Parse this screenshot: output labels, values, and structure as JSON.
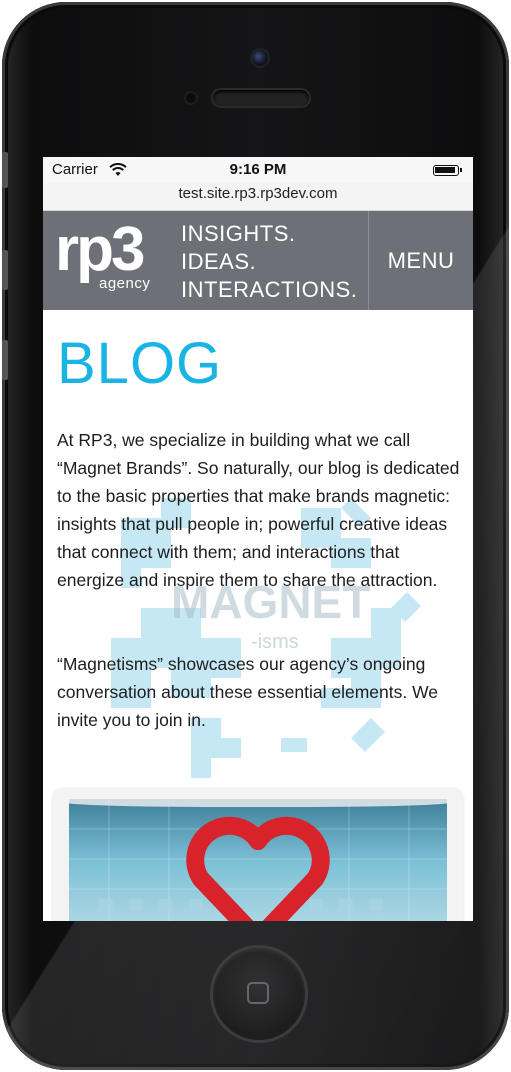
{
  "status_bar": {
    "carrier": "Carrier",
    "time": "9:16 PM"
  },
  "browser": {
    "url": "test.site.rp3.rp3dev.com"
  },
  "header": {
    "logo_text": "rp3",
    "logo_sub": "agency",
    "tagline": [
      "INSIGHTS.",
      "IDEAS.",
      "INTERACTIONS."
    ],
    "menu_label": "MENU"
  },
  "page": {
    "title": "BLOG",
    "paragraphs": [
      "At RP3, we specialize in building what we call “Magnet Brands”. So naturally, our blog is dedicated to the basic properties that make brands magnetic: insights that pull people in; powerful creative ideas that connect with them; and interactions that energize and inspire them to share the attraction.",
      "“Magnetisms” showcases our agency’s ongoing conversation about these essential elements. We invite you to join in."
    ],
    "background_graphic_text": {
      "main": "MAGNET",
      "sub": "-isms"
    }
  },
  "colors": {
    "header_bg": "#6d7077",
    "title_accent": "#19b4e3",
    "graphic": "#bfe6f3",
    "heart": "#d8232a"
  },
  "icons": [
    "wifi-icon",
    "battery-icon",
    "camera",
    "home-button"
  ]
}
